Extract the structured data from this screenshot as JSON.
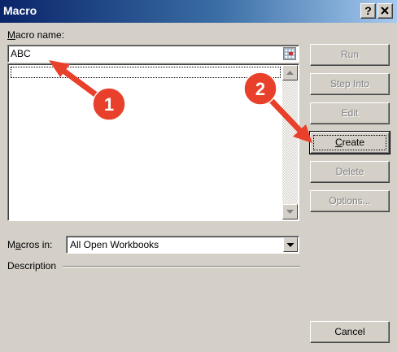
{
  "window": {
    "title": "Macro",
    "help_button": "?",
    "close_button": "X"
  },
  "macro_name": {
    "label_hotkey": "M",
    "label_rest": "acro name:",
    "value": "ABC"
  },
  "buttons": {
    "run": "Run",
    "step_into": "Step Into",
    "edit": "Edit",
    "create_hotkey": "C",
    "create_rest": "reate",
    "delete": "Delete",
    "options": "Options...",
    "cancel": "Cancel"
  },
  "macros_in": {
    "label_prefix": "M",
    "label_hotkey": "a",
    "label_rest": "cros in:",
    "value": "All Open Workbooks"
  },
  "description": {
    "label": "Description"
  },
  "annotations": {
    "step1": "1",
    "step2": "2",
    "color": "#e8402a"
  }
}
